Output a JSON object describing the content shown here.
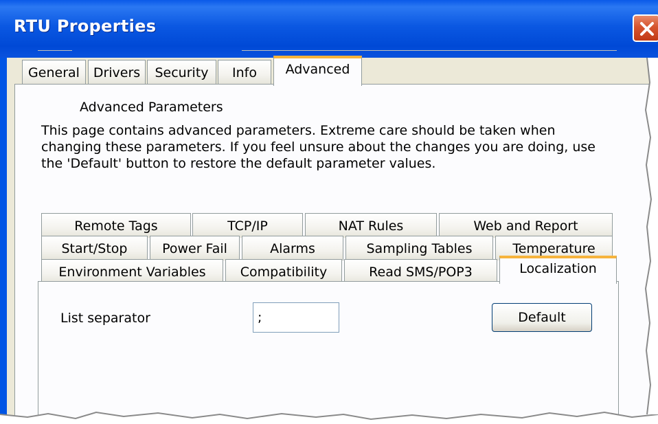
{
  "window": {
    "title": "RTU Properties"
  },
  "main_tabs": [
    {
      "label": "General",
      "active": false
    },
    {
      "label": "Drivers",
      "active": false
    },
    {
      "label": "Security",
      "active": false
    },
    {
      "label": "Info",
      "active": false
    },
    {
      "label": "Advanced",
      "active": true
    }
  ],
  "advanced": {
    "group_title": "Advanced Parameters",
    "description": "This page contains advanced parameters. Extreme care should be taken when changing these parameters. If you feel unsure about the changes you are doing, use the 'Default' button to restore the default parameter values."
  },
  "sub_tabs": {
    "row1": [
      "Remote Tags",
      "TCP/IP",
      "NAT Rules",
      "Web and Report"
    ],
    "row2": [
      "Start/Stop",
      "Power Fail",
      "Alarms",
      "Sampling Tables",
      "Temperature"
    ],
    "row3": [
      "Environment Variables",
      "Compatibility",
      "Read SMS/POP3",
      "Localization"
    ],
    "active": "Localization"
  },
  "localization": {
    "list_separator_label": "List separator",
    "list_separator_value": ";",
    "default_button": "Default"
  },
  "colors": {
    "titlebar": "#0055e5",
    "dialog_bg": "#ece9d8",
    "active_tab_accent": "#f6b43c",
    "close_button": "#d6542e"
  },
  "icons": {
    "close": "close-icon"
  }
}
